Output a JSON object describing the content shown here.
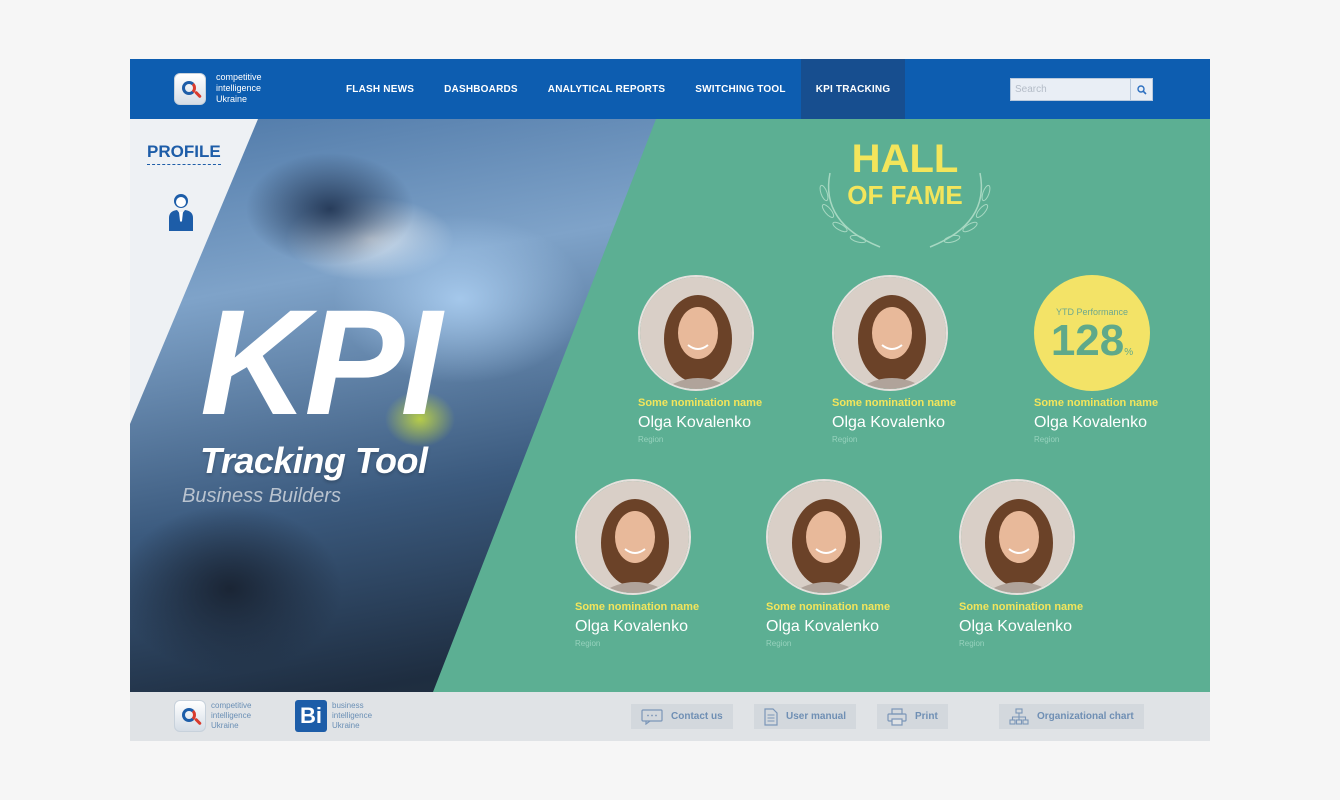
{
  "header": {
    "logo_lines": [
      "competitive",
      "intelligence",
      "Ukraine"
    ],
    "nav": [
      {
        "label": "FLASH NEWS",
        "active": false
      },
      {
        "label": "DASHBOARDS",
        "active": false
      },
      {
        "label": "ANALYTICAL REPORTS",
        "active": false
      },
      {
        "label": "SWITCHING TOOL",
        "active": false
      },
      {
        "label": "KPI TRACKING",
        "active": true
      }
    ],
    "search_placeholder": "Search"
  },
  "profile": {
    "label": "PROFILE",
    "icon": "user-icon"
  },
  "hero": {
    "title": "KPI",
    "subtitle": "Tracking Tool",
    "tagline": "Business Builders"
  },
  "hall_of_fame": {
    "line1": "HALL",
    "line2": "OF FAME"
  },
  "people": [
    {
      "nomination": "Some nomination name",
      "name": "Olga Kovalenko",
      "region": "Region"
    },
    {
      "nomination": "Some nomination name",
      "name": "Olga Kovalenko",
      "region": "Region"
    },
    {
      "nomination": "Some nomination name",
      "name": "Olga Kovalenko",
      "region": "Region"
    },
    {
      "nomination": "Some nomination name",
      "name": "Olga Kovalenko",
      "region": "Region"
    },
    {
      "nomination": "Some nomination name",
      "name": "Olga Kovalenko",
      "region": "Region"
    },
    {
      "nomination": "Some nomination name",
      "name": "Olga Kovalenko",
      "region": "Region"
    }
  ],
  "ytd": {
    "label": "YTD Performance",
    "value": "128",
    "unit": "%"
  },
  "footer": {
    "logo1_lines": [
      "competitive",
      "intelligence",
      "Ukraine"
    ],
    "logo2_lines": [
      "business",
      "intelligence",
      "Ukraine"
    ],
    "logo2_mark": "Bi",
    "buttons": {
      "contact": "Contact us",
      "manual": "User manual",
      "print": "Print",
      "org": "Organizational chart"
    }
  },
  "colors": {
    "header_blue": "#0d5db0",
    "teal": "#5caf93",
    "accent_yellow": "#f3e55b"
  }
}
